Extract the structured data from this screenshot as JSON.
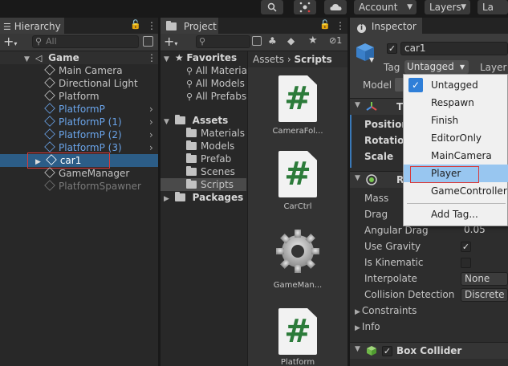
{
  "toolbar": {
    "account": "Account",
    "layers": "Layers",
    "layout_partial": "La"
  },
  "hierarchy": {
    "tab": "Hierarchy",
    "search_placeholder": "All",
    "scene": "Game",
    "items": [
      {
        "label": "Main Camera",
        "style": "normal"
      },
      {
        "label": "Directional Light",
        "style": "normal"
      },
      {
        "label": "Platform",
        "style": "normal"
      },
      {
        "label": "PlatformP",
        "style": "prefab"
      },
      {
        "label": "PlatformP (1)",
        "style": "prefab"
      },
      {
        "label": "PlatformP (2)",
        "style": "prefab"
      },
      {
        "label": "PlatformP (3)",
        "style": "prefab"
      },
      {
        "label": "car1",
        "style": "selected"
      },
      {
        "label": "GameManager",
        "style": "normal"
      },
      {
        "label": "PlatformSpawner",
        "style": "disabled"
      }
    ]
  },
  "project": {
    "tab": "Project",
    "favorites": "Favorites",
    "favorites_items": [
      "All Materia",
      "All Models",
      "All Prefabs"
    ],
    "assets": "Assets",
    "assets_items": [
      "Materials",
      "Models",
      "Prefab",
      "Scenes",
      "Scripts"
    ],
    "packages": "Packages",
    "breadcrumb_root": "Assets",
    "breadcrumb_sep": "›",
    "breadcrumb_current": "Scripts",
    "hidden_count": "1",
    "files": [
      {
        "label": "CameraFol...",
        "kind": "script"
      },
      {
        "label": "CarCtrl",
        "kind": "script"
      },
      {
        "label": "GameMan...",
        "kind": "gear"
      },
      {
        "label": "Platform",
        "kind": "script"
      }
    ]
  },
  "inspector": {
    "tab": "Inspector",
    "object_name": "car1",
    "tag_label": "Tag",
    "tag_value": "Untagged",
    "layer_label": "Layer",
    "model_label": "Model",
    "transform_partial": "T",
    "position": "Position",
    "rotation": "Rotation",
    "scale": "Scale",
    "rigidbody_partial": "R",
    "mass": "Mass",
    "drag": "Drag",
    "angular_drag": "Angular Drag",
    "angular_drag_value": "0.05",
    "use_gravity": "Use Gravity",
    "is_kinematic": "Is Kinematic",
    "interpolate": "Interpolate",
    "interpolate_value": "None",
    "collision": "Collision Detection",
    "collision_value": "Discrete",
    "constraints": "Constraints",
    "info": "Info",
    "box_collider": "Box Collider"
  },
  "tag_dropdown": {
    "items": [
      "Untagged",
      "Respawn",
      "Finish",
      "EditorOnly",
      "MainCamera",
      "Player",
      "GameController"
    ],
    "checked": "Untagged",
    "highlighted": "Player",
    "add_tag": "Add Tag..."
  },
  "colors": {
    "selection_blue": "#2c5d87",
    "prefab_blue": "#6aa4ea",
    "highlight_red": "#d83a3a",
    "dropdown_highlight": "#98c6f0"
  }
}
